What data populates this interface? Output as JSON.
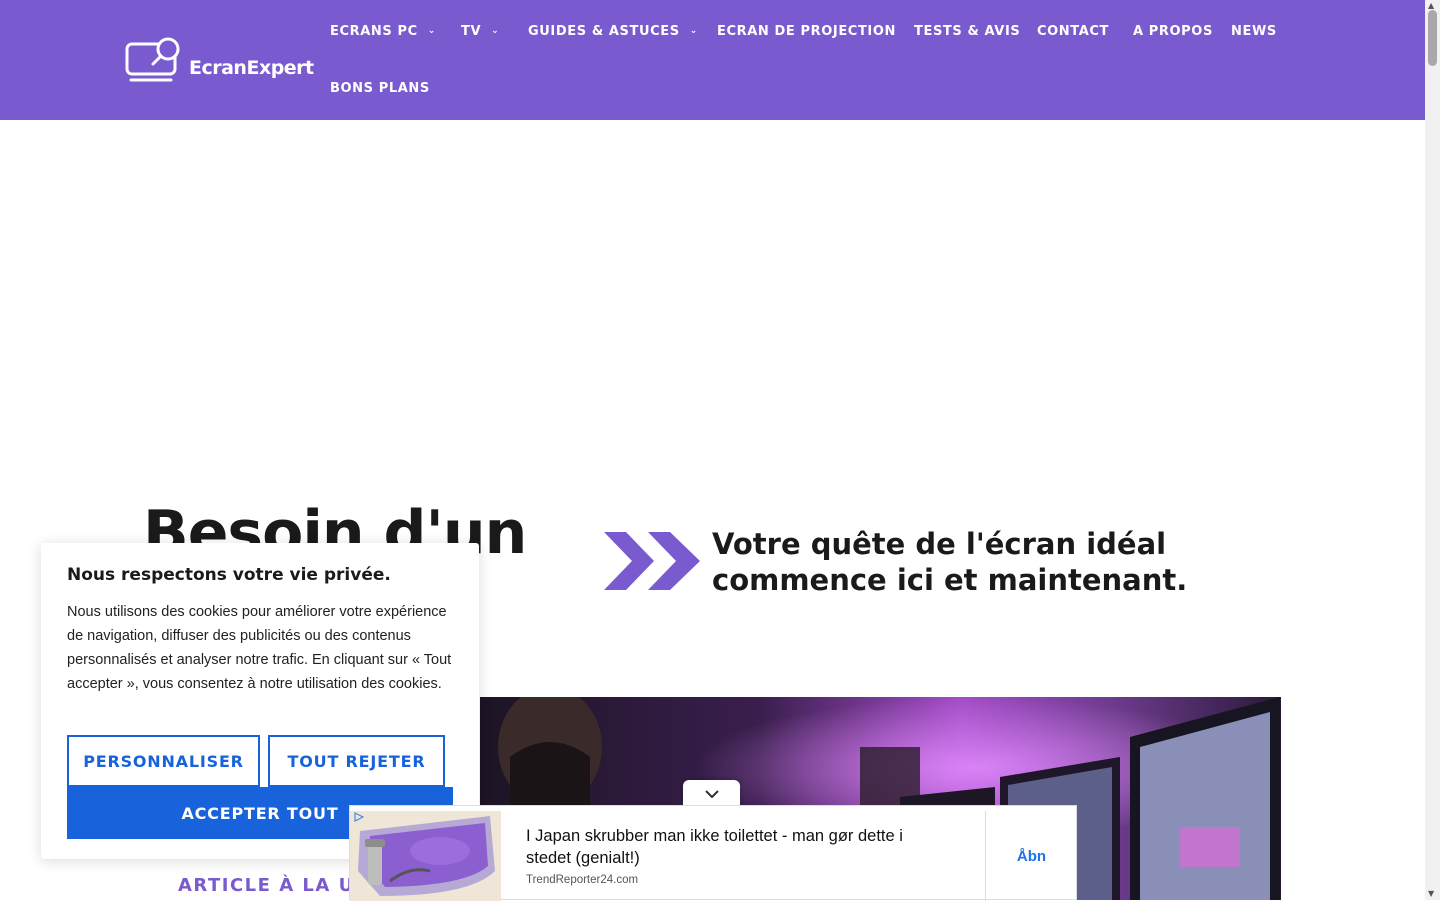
{
  "header": {
    "logo_text": "EcranExpert",
    "nav": [
      {
        "label": "ECRANS PC",
        "has_dropdown": true
      },
      {
        "label": "TV",
        "has_dropdown": true
      },
      {
        "label": "GUIDES & ASTUCES",
        "has_dropdown": true
      },
      {
        "label": "ECRAN DE PROJECTION",
        "has_dropdown": false
      },
      {
        "label": "TESTS & AVIS",
        "has_dropdown": false
      },
      {
        "label": "CONTACT",
        "has_dropdown": false
      },
      {
        "label": "A PROPOS",
        "has_dropdown": false
      },
      {
        "label": "NEWS",
        "has_dropdown": false
      },
      {
        "label": "BONS PLANS",
        "has_dropdown": false
      }
    ],
    "dropdown_icon": "chevron-down-icon"
  },
  "hero": {
    "title": "Besoin d'un",
    "tagline": "Votre quête de l'écran idéal commence ici et maintenant.",
    "article_label": "ARTICLE À LA UNE"
  },
  "cookie_banner": {
    "title": "Nous respectons votre vie privée.",
    "body": "Nous utilisons des cookies pour améliorer votre expérience de navigation, diffuser des publicités ou des contenus personnalisés et analyser notre trafic. En cliquant sur « Tout accepter », vous consentez à notre utilisation des cookies.",
    "customize_label": "PERSONNALISER",
    "reject_label": "TOUT REJETER",
    "accept_label": "ACCEPTER TOUT"
  },
  "ad": {
    "text": "I Japan skrubber man ikke toilettet - man gør dette i stedet (genialt!)",
    "source": "TrendReporter24.com",
    "cta": "Åbn"
  },
  "colors": {
    "brand_purple": "#7a5acf",
    "accent_blue": "#1863dc"
  }
}
